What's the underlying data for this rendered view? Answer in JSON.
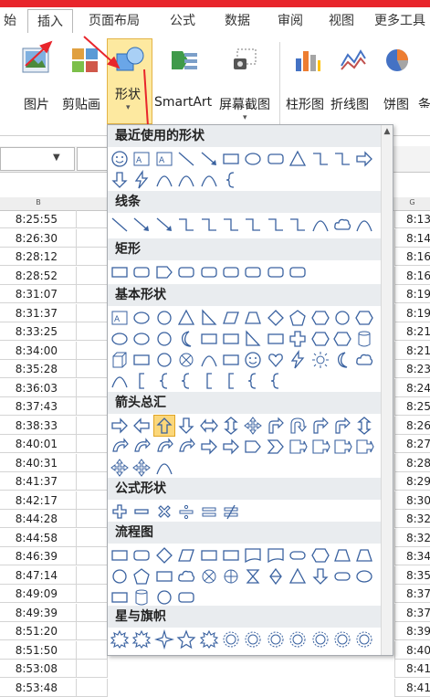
{
  "tabs": [
    "始",
    "插入",
    "页面布局",
    "公式",
    "数据",
    "审阅",
    "视图",
    "更多工具"
  ],
  "ribbon": {
    "picture": "图片",
    "clipart": "剪贴画",
    "shape": "形状",
    "smartart": "SmartArt",
    "screenshot": "屏幕截图",
    "column_chart": "柱形图",
    "line_chart": "折线图",
    "pie_chart": "饼图",
    "more": "条"
  },
  "colors": {
    "accent_red": "#e8252b",
    "shape_button_bg": "#fde9a0",
    "shape_stroke": "#3a62a0"
  },
  "sheet": {
    "col_b_header": "B",
    "col_g_header": "G",
    "col_b": [
      "8:25:55",
      "8:26:30",
      "8:28:12",
      "8:28:52",
      "8:31:07",
      "8:31:37",
      "8:33:25",
      "8:34:00",
      "8:35:28",
      "8:36:03",
      "8:37:43",
      "8:38:33",
      "8:40:01",
      "8:40:31",
      "8:41:37",
      "8:42:17",
      "8:44:28",
      "8:44:58",
      "8:46:39",
      "8:47:14",
      "8:49:09",
      "8:49:39",
      "8:51:20",
      "8:51:50",
      "8:53:08",
      "8:53:48"
    ],
    "col_g": [
      "8:13:",
      "8:14:",
      "8:16:",
      "8:16:",
      "8:19:",
      "8:19:",
      "8:21:",
      "8:21:",
      "8:23:",
      "8:24:",
      "8:25:",
      "8:26:",
      "8:27:",
      "8:28:",
      "8:29:",
      "8:30:",
      "8:32:",
      "8:32:",
      "8:34:",
      "8:35:",
      "8:37:",
      "8:37:",
      "8:39:",
      "8:40:",
      "8:41:",
      "8:41:"
    ]
  },
  "gallery": {
    "sections": [
      "最近使用的形状",
      "线条",
      "矩形",
      "基本形状",
      "箭头总汇",
      "公式形状",
      "流程图",
      "星与旗帜"
    ]
  }
}
